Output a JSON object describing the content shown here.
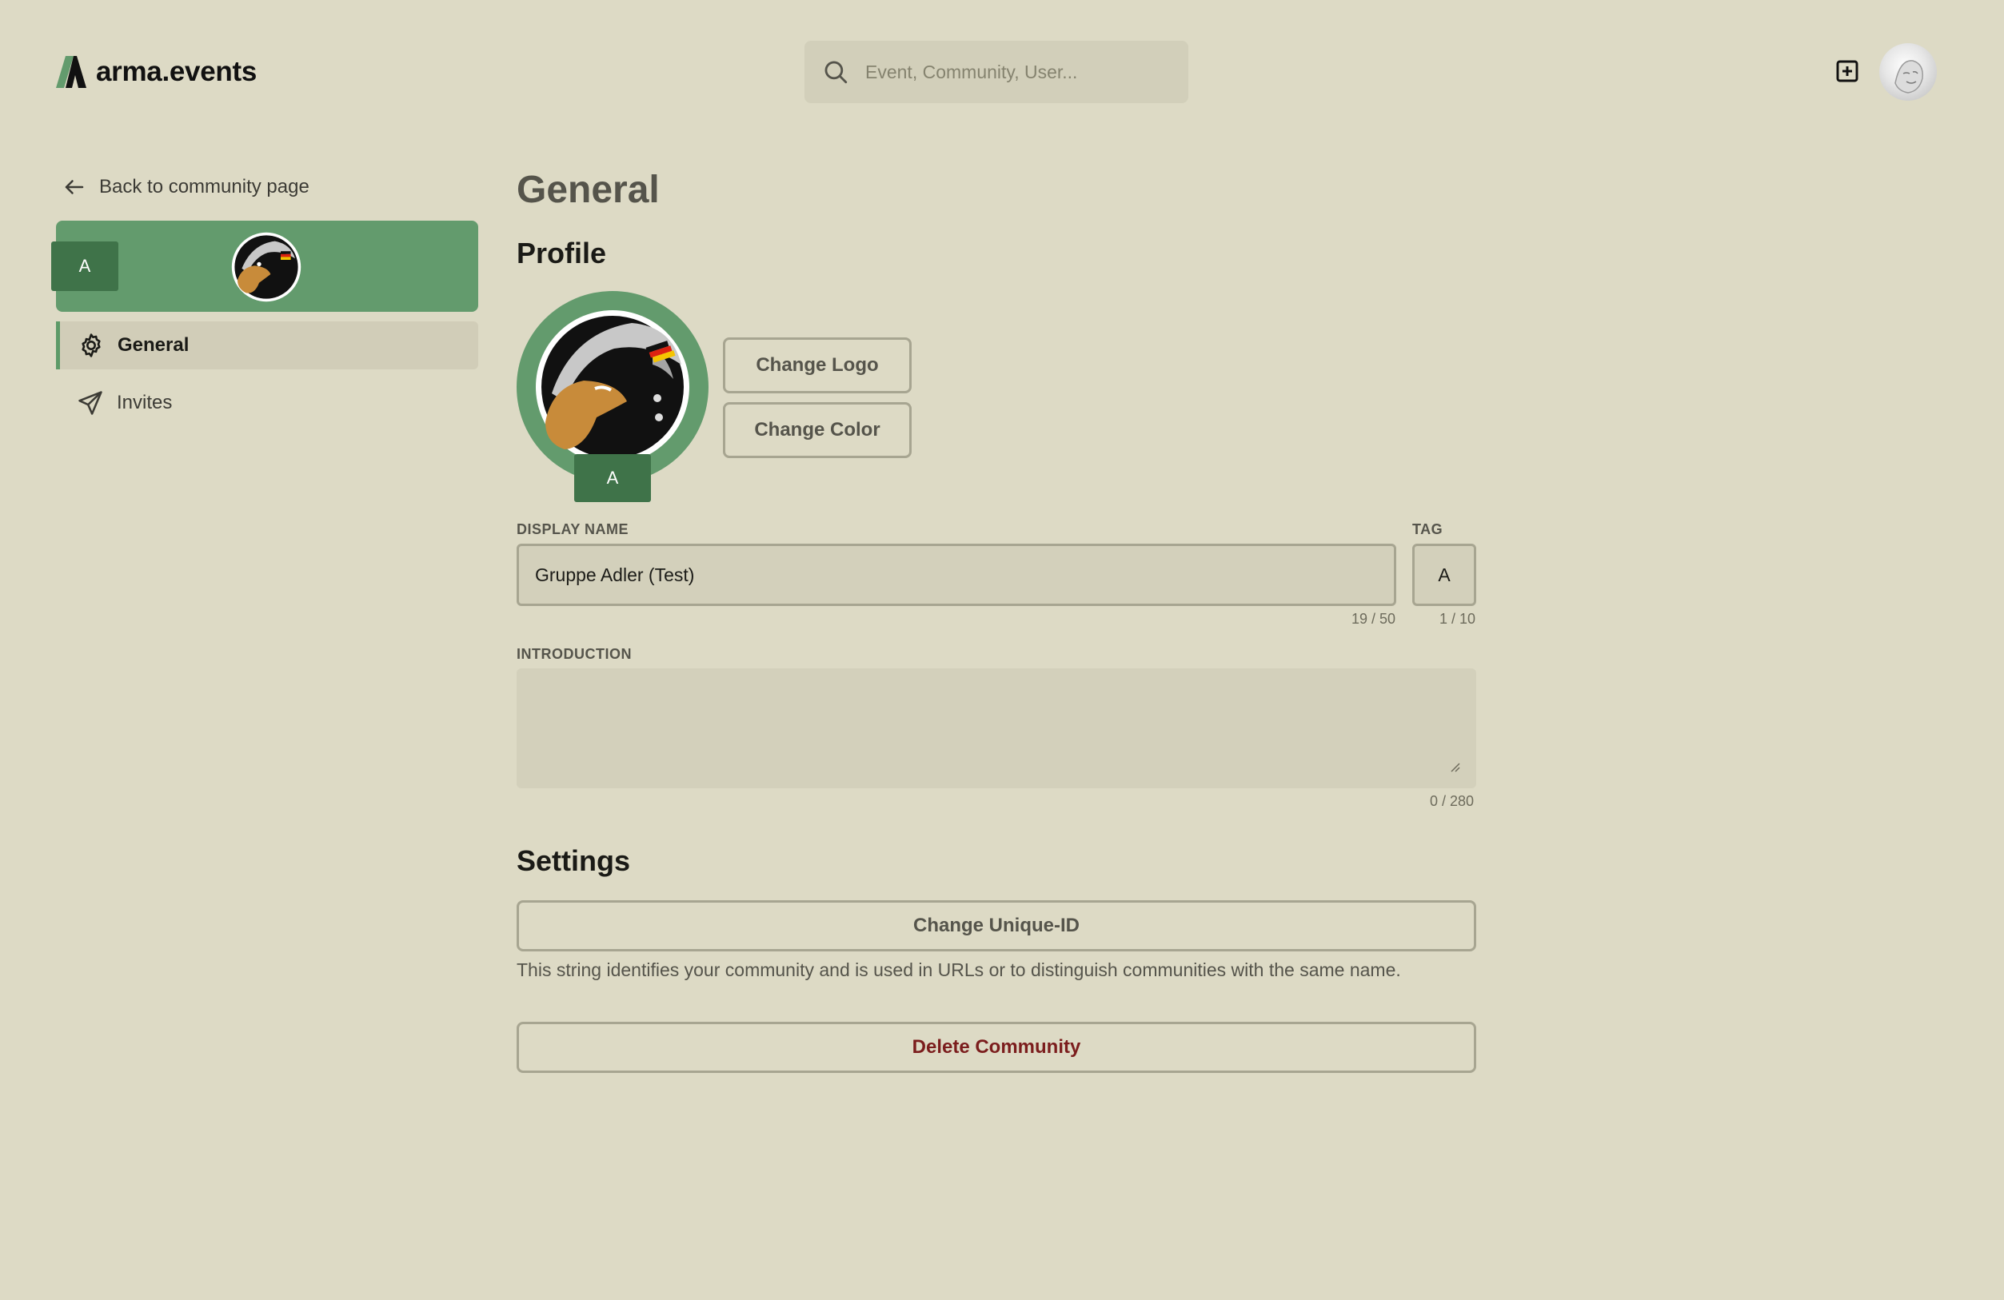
{
  "header": {
    "brand": "arma.events",
    "search_placeholder": "Event, Community, User...",
    "create_icon": "plus-square-icon",
    "avatar_icon": "user-avatar"
  },
  "sidebar": {
    "back_label": "Back to community page",
    "community_tag": "A",
    "nav": [
      {
        "label": "General",
        "icon": "gear-icon",
        "active": true
      },
      {
        "label": "Invites",
        "icon": "paper-plane-icon",
        "active": false
      }
    ]
  },
  "main": {
    "title": "General",
    "profile_heading": "Profile",
    "logo_tag": "A",
    "change_logo": "Change Logo",
    "change_color": "Change Color",
    "display_name_label": "DISPLAY NAME",
    "display_name_value": "Gruppe Adler (Test)",
    "display_name_counter": "19 / 50",
    "tag_label": "TAG",
    "tag_value": "A",
    "tag_counter": "1 / 10",
    "intro_label": "INTRODUCTION",
    "intro_value": "",
    "intro_counter": "0 / 280",
    "settings_heading": "Settings",
    "change_uid": "Change Unique-ID",
    "uid_description": "This string identifies your community and is used in URLs or to distinguish communities with the same name.",
    "delete_community": "Delete Community"
  },
  "colors": {
    "background": "#dddac5",
    "accent": "#639b6d",
    "tag_bg": "#3f7349",
    "danger": "#7b1d1d"
  }
}
